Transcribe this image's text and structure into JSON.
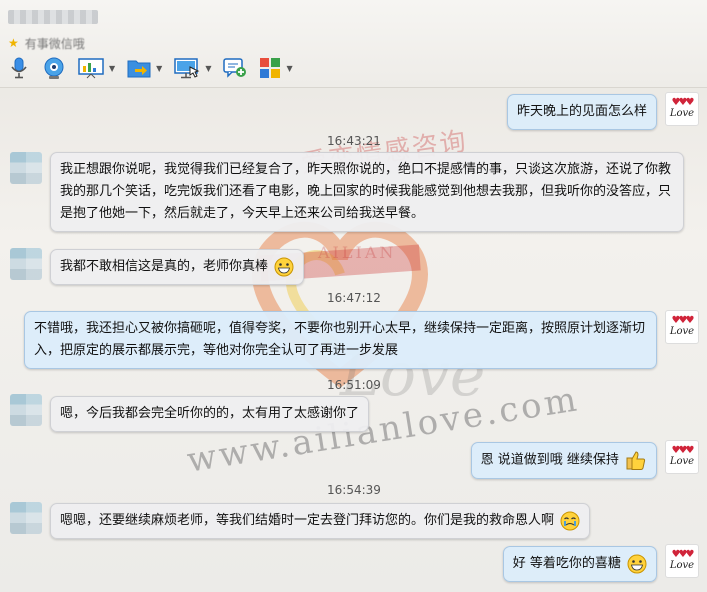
{
  "header": {
    "signature": "有事微信哦",
    "toolbar": [
      {
        "name": "microphone-icon"
      },
      {
        "name": "video-camera-icon"
      },
      {
        "name": "whiteboard-icon"
      },
      {
        "name": "send-file-icon"
      },
      {
        "name": "screen-share-icon"
      },
      {
        "name": "add-chat-icon"
      },
      {
        "name": "apps-icon"
      }
    ]
  },
  "watermark": {
    "cn": "爱恋情感咨询",
    "ailian": "AILIAN",
    "love": "Love",
    "url": "www.ailianlove.com"
  },
  "avatar_right_label": "Love",
  "messages": [
    {
      "side": "out",
      "text": "昨天晚上的见面怎么样"
    },
    {
      "time": "16:43:21"
    },
    {
      "side": "in",
      "text": "我正想跟你说呢，我觉得我们已经复合了，昨天照你说的，绝口不提感情的事，只谈这次旅游，还说了你教我的那几个笑话，吃完饭我们还看了电影，晚上回家的时候我能感觉到他想去我那，但我听你的没答应，只是抱了他她一下，然后就走了，今天早上还来公司给我送早餐。"
    },
    {
      "side": "in",
      "text": "我都不敢相信这是真的，老师你真棒"
    },
    {
      "time": "16:47:12"
    },
    {
      "side": "out",
      "text": "不错哦，我还担心又被你搞砸呢，值得夸奖，不要你也别开心太早，继续保持一定距离，按照原计划逐渐切入，把原定的展示都展示完，等他对你完全认可了再进一步发展"
    },
    {
      "time": "16:51:09"
    },
    {
      "side": "in",
      "text": "嗯，今后我都会完全听你的的，太有用了太感谢你了"
    },
    {
      "side": "out",
      "text": "恩 说道做到哦  继续保持"
    },
    {
      "time": "16:54:39"
    },
    {
      "side": "in",
      "text": "嗯嗯，还要继续麻烦老师，等我们结婚时一定去登门拜访您的。你们是我的救命恩人啊"
    },
    {
      "side": "out",
      "text": "好  等着吃你的喜糖"
    }
  ]
}
